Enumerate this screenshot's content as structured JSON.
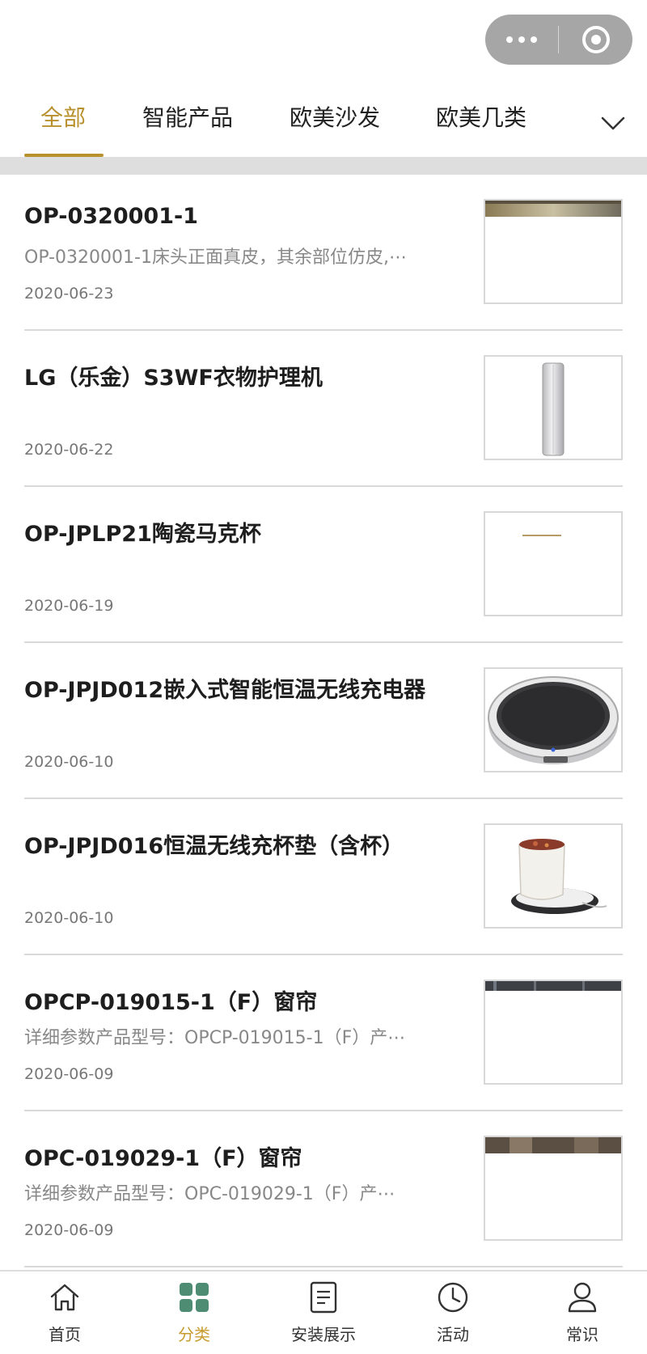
{
  "capsule": {
    "more_icon": "more-dots-icon",
    "close_icon": "target-close-icon"
  },
  "tabs": {
    "items": [
      {
        "label": "全部",
        "active": true
      },
      {
        "label": "智能产品",
        "active": false
      },
      {
        "label": "欧美沙发",
        "active": false
      },
      {
        "label": "欧美几类",
        "active": false
      }
    ],
    "expand_icon": "chevron-down-icon",
    "accent_color": "#b8902d"
  },
  "list": {
    "items": [
      {
        "title": "OP-0320001-1",
        "desc": "OP-0320001-1床头正面真皮，其余部位仿皮,⋯",
        "date": "2020-06-23",
        "thumb": "room-photo"
      },
      {
        "title": "LG（乐金）S3WF衣物护理机",
        "desc": "",
        "date": "2020-06-22",
        "thumb": "clothing-care-machine"
      },
      {
        "title": "OP-JPLP21陶瓷马克杯",
        "desc": "",
        "date": "2020-06-19",
        "thumb": "mug-line"
      },
      {
        "title": "OP-JPJD012嵌入式智能恒温无线充电器",
        "desc": "",
        "date": "2020-06-10",
        "thumb": "wireless-charger"
      },
      {
        "title": "OP-JPJD016恒温无线充杯垫（含杯）",
        "desc": "",
        "date": "2020-06-10",
        "thumb": "cup-warmer"
      },
      {
        "title": "OPCP-019015-1（F）窗帘",
        "desc": "详细参数产品型号：OPCP-019015-1（F）产⋯",
        "date": "2020-06-09",
        "thumb": "curtain-photo"
      },
      {
        "title": "OPC-019029-1（F）窗帘",
        "desc": "详细参数产品型号：OPC-019029-1（F）产⋯",
        "date": "2020-06-09",
        "thumb": "curtain-photo-2"
      }
    ]
  },
  "bottom_nav": {
    "items": [
      {
        "label": "首页",
        "icon": "home-icon",
        "active": false
      },
      {
        "label": "分类",
        "icon": "grid-icon",
        "active": true
      },
      {
        "label": "安装展示",
        "icon": "document-icon",
        "active": false
      },
      {
        "label": "活动",
        "icon": "clock-icon",
        "active": false
      },
      {
        "label": "常识",
        "icon": "user-icon",
        "active": false
      }
    ],
    "active_color": "#c89b2e",
    "active_icon_color": "#4e8c73"
  }
}
